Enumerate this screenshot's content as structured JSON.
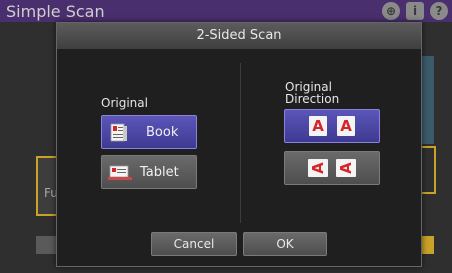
{
  "background": {
    "app_title": "Simple Scan",
    "left_tile_text": "Fu",
    "icons": [
      "globe-icon",
      "info-icon",
      "help-icon"
    ]
  },
  "dialog": {
    "title": "2-Sided Scan",
    "original": {
      "label": "Original",
      "options": [
        {
          "label": "Book",
          "selected": true,
          "icon": "book-icon"
        },
        {
          "label": "Tablet",
          "selected": false,
          "icon": "tablet-icon"
        }
      ]
    },
    "direction": {
      "label": "Original Direction",
      "label_line1": "Original",
      "label_line2": "Direction",
      "options": [
        {
          "glyph": "A",
          "orientation": "upright",
          "selected": true
        },
        {
          "glyph": "A",
          "orientation": "rotated",
          "selected": false
        }
      ]
    },
    "cancel_label": "Cancel",
    "ok_label": "OK"
  },
  "colors": {
    "selected": "#4a45a6",
    "header": "#4a2f6e",
    "accent": "#c9a227",
    "glyph": "#d6252a"
  }
}
